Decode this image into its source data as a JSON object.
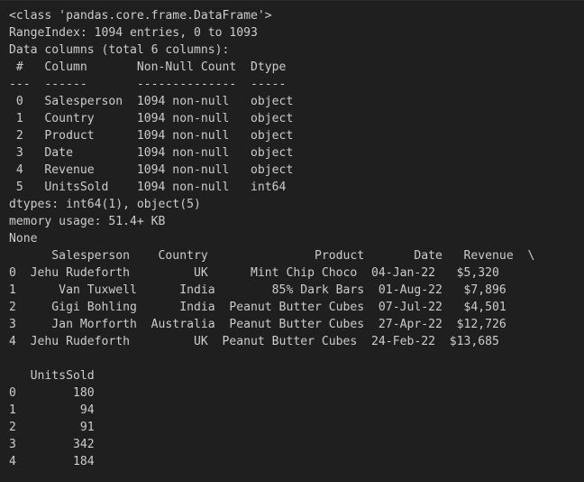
{
  "output": {
    "lines": [
      "<class 'pandas.core.frame.DataFrame'>",
      "RangeIndex: 1094 entries, 0 to 1093",
      "Data columns (total 6 columns):",
      " #   Column       Non-Null Count  Dtype ",
      "---  ------       --------------  ----- ",
      " 0   Salesperson  1094 non-null   object",
      " 1   Country      1094 non-null   object",
      " 2   Product      1094 non-null   object",
      " 3   Date         1094 non-null   object",
      " 4   Revenue      1094 non-null   object",
      " 5   UnitsSold    1094 non-null   int64 ",
      "dtypes: int64(1), object(5)",
      "memory usage: 51.4+ KB",
      "None",
      "      Salesperson    Country               Product       Date   Revenue  \\",
      "0  Jehu Rudeforth         UK      Mint Chip Choco  04-Jan-22   $5,320   ",
      "1      Van Tuxwell      India        85% Dark Bars  01-Aug-22   $7,896   ",
      "2     Gigi Bohling      India  Peanut Butter Cubes  07-Jul-22   $4,501   ",
      "3     Jan Morforth  Australia  Peanut Butter Cubes  27-Apr-22  $12,726   ",
      "4  Jehu Rudeforth         UK  Peanut Butter Cubes  24-Feb-22  $13,685   ",
      "",
      "   UnitsSold  ",
      "0        180  ",
      "1         94  ",
      "2         91  ",
      "3        342  ",
      "4        184  "
    ]
  }
}
